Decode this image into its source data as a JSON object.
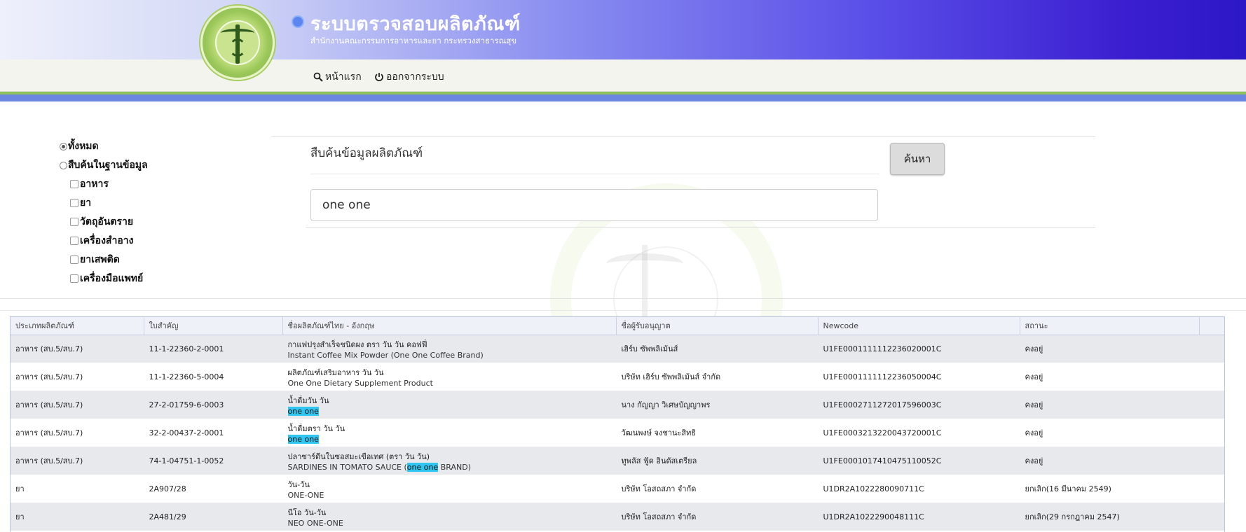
{
  "header": {
    "title": "ระบบตรวจสอบผลิตภัณฑ์",
    "subtitle": "สำนักงานคณะกรรมการอาหารและยา กระทรวงสาธารณสุข"
  },
  "nav": {
    "home_label": "หน้าแรก",
    "logout_label": "ออกจากระบบ"
  },
  "filters": {
    "all_label": "ทั้งหมด",
    "db_label": "สืบค้นในฐานข้อมูล",
    "categories": [
      "อาหาร",
      "ยา",
      "วัตถุอันตราย",
      "เครื่องสำอาง",
      "ยาเสพติด",
      "เครื่องมือแพทย์"
    ],
    "selected": "ทั้งหมด"
  },
  "search": {
    "label": "สืบค้นข้อมูลผลิตภัณฑ์",
    "value": "one one",
    "button_label": "ค้นหา"
  },
  "table": {
    "columns": [
      "ประเภทผลิตภัณฑ์",
      "ใบสำคัญ",
      "ชื่อผลิตภัณฑ์ไทย - อังกฤษ",
      "ชื่อผู้รับอนุญาต",
      "Newcode",
      "สถานะ"
    ],
    "rows": [
      {
        "type": "อาหาร (สบ.5/สบ.7)",
        "license": "11-1-22360-2-0001",
        "name_th": "กาแฟปรุงสำเร็จชนิดผง ตรา วัน วัน คอฟฟี่",
        "name_en": "Instant Coffee Mix Powder (One One Coffee Brand)",
        "licensee": "เฮิร์บ ซัพพลิเม้นส์",
        "newcode": "U1FE0001111112236020001C",
        "status": "คงอยู่"
      },
      {
        "type": "อาหาร (สบ.5/สบ.7)",
        "license": "11-1-22360-5-0004",
        "name_th": "ผลิตภัณฑ์เสริมอาหาร วัน วัน",
        "name_en": "One One Dietary Supplement Product",
        "licensee": "บริษัท เฮิร์บ ซัพพลิเม้นส์ จำกัด",
        "newcode": "U1FE0001111112236050004C",
        "status": "คงอยู่"
      },
      {
        "type": "อาหาร (สบ.5/สบ.7)",
        "license": "27-2-01759-6-0003",
        "name_th": "น้ำดื่มวัน วัน",
        "name_en": "one one",
        "licensee": "นาง กัญญา วิเศษบัญญาพร",
        "newcode": "U1FE0002711272017596003C",
        "status": "คงอยู่"
      },
      {
        "type": "อาหาร (สบ.5/สบ.7)",
        "license": "32-2-00437-2-0001",
        "name_th": "น้ำดื่มตรา วัน วัน",
        "name_en": "one one",
        "licensee": "วัฒนพงษ์ จงชานะสิทธิ",
        "newcode": "U1FE0003213220043720001C",
        "status": "คงอยู่"
      },
      {
        "type": "อาหาร (สบ.5/สบ.7)",
        "license": "74-1-04751-1-0052",
        "name_th": "ปลาซาร์ดีนในซอสมะเขือเทศ (ตรา วัน วัน)",
        "name_en_pre": "SARDINES IN TOMATO SAUCE (",
        "name_en": "one one",
        "name_en_post": " BRAND)",
        "licensee": "ทูพลัส ฟู้ด อินดัสเตรียล",
        "newcode": "U1FE0001017410475110052C",
        "status": "คงอยู่"
      },
      {
        "type": "ยา",
        "license": "2A907/28",
        "name_th": "วัน-วัน",
        "name_en": "ONE-ONE",
        "licensee": "บริษัท โอสถสภา จำกัด",
        "newcode": "U1DR2A1022280090711C",
        "status": "ยกเลิก(16 มีนาคม 2549)"
      },
      {
        "type": "ยา",
        "license": "2A481/29",
        "name_th": "นีโอ วัน-วัน",
        "name_en": "NEO ONE-ONE",
        "licensee": "บริษัท โอสถสภา จำกัด",
        "newcode": "U1DR2A1022290048111C",
        "status": "ยกเลิก(29 กรกฎาคม 2547)"
      }
    ]
  },
  "colors": {
    "header_gradient_end": "#2c17c6",
    "stripe_green": "#8fc15b",
    "stripe_blue": "#6b86e0",
    "highlight": "#2fc6f2"
  }
}
